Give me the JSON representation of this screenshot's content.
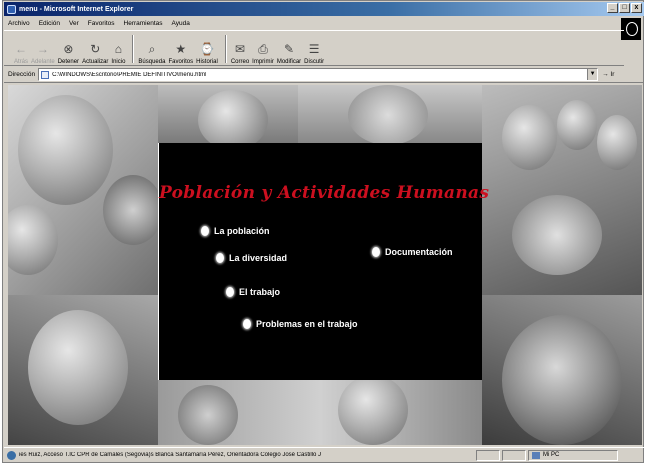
{
  "window": {
    "title": "menu - Microsoft Internet Explorer",
    "buttons": [
      "_",
      "□",
      "x"
    ]
  },
  "menubar": {
    "items": [
      "Archivo",
      "Edición",
      "Ver",
      "Favoritos",
      "Herramientas",
      "Ayuda"
    ]
  },
  "toolbar": {
    "buttons": [
      {
        "label": "Atrás",
        "icon": "back-arrow-icon",
        "glyph": "←",
        "enabled": false
      },
      {
        "label": "Adelante",
        "icon": "forward-arrow-icon",
        "glyph": "→",
        "enabled": false
      },
      {
        "label": "Detener",
        "icon": "stop-icon",
        "glyph": "⊗",
        "enabled": true
      },
      {
        "label": "Actualizar",
        "icon": "refresh-icon",
        "glyph": "↻",
        "enabled": true
      },
      {
        "label": "Inicio",
        "icon": "home-icon",
        "glyph": "⌂",
        "enabled": true
      },
      {
        "label": "Búsqueda",
        "icon": "search-icon",
        "glyph": "⌕",
        "enabled": true
      },
      {
        "label": "Favoritos",
        "icon": "favorites-icon",
        "glyph": "★",
        "enabled": true
      },
      {
        "label": "Historial",
        "icon": "history-icon",
        "glyph": "⌚",
        "enabled": true
      },
      {
        "label": "Correo",
        "icon": "mail-icon",
        "glyph": "✉",
        "enabled": true
      },
      {
        "label": "Imprimir",
        "icon": "print-icon",
        "glyph": "⎙",
        "enabled": true
      },
      {
        "label": "Modificar",
        "icon": "edit-icon",
        "glyph": "✎",
        "enabled": true
      },
      {
        "label": "Discutir",
        "icon": "discuss-icon",
        "glyph": "☰",
        "enabled": true
      }
    ]
  },
  "address": {
    "label": "Dirección",
    "url": "C:\\WINDOWS\\Escritorio\\PREMIE DEFINITIVO\\menu.html",
    "go_label": "Ir"
  },
  "page": {
    "heading": "Población y Actividades Humanas",
    "menu_items": [
      {
        "label": "La población"
      },
      {
        "label": "La diversidad"
      },
      {
        "label": "El trabajo"
      },
      {
        "label": "Problemas en el trabajo"
      },
      {
        "label": "Documentación"
      }
    ]
  },
  "status": {
    "text": "ies Ruiz, Acceso T.IC CPR de Camales (Segovia)s Blanca Santamaría Pérez, Orientadora Colegio José Castillo J",
    "zone": "Mi PC"
  },
  "colors": {
    "title_gradient_start": "#0a246a",
    "heading_red": "#cc0f1f",
    "menu_background": "#000000",
    "chrome": "#d4d0c8"
  }
}
